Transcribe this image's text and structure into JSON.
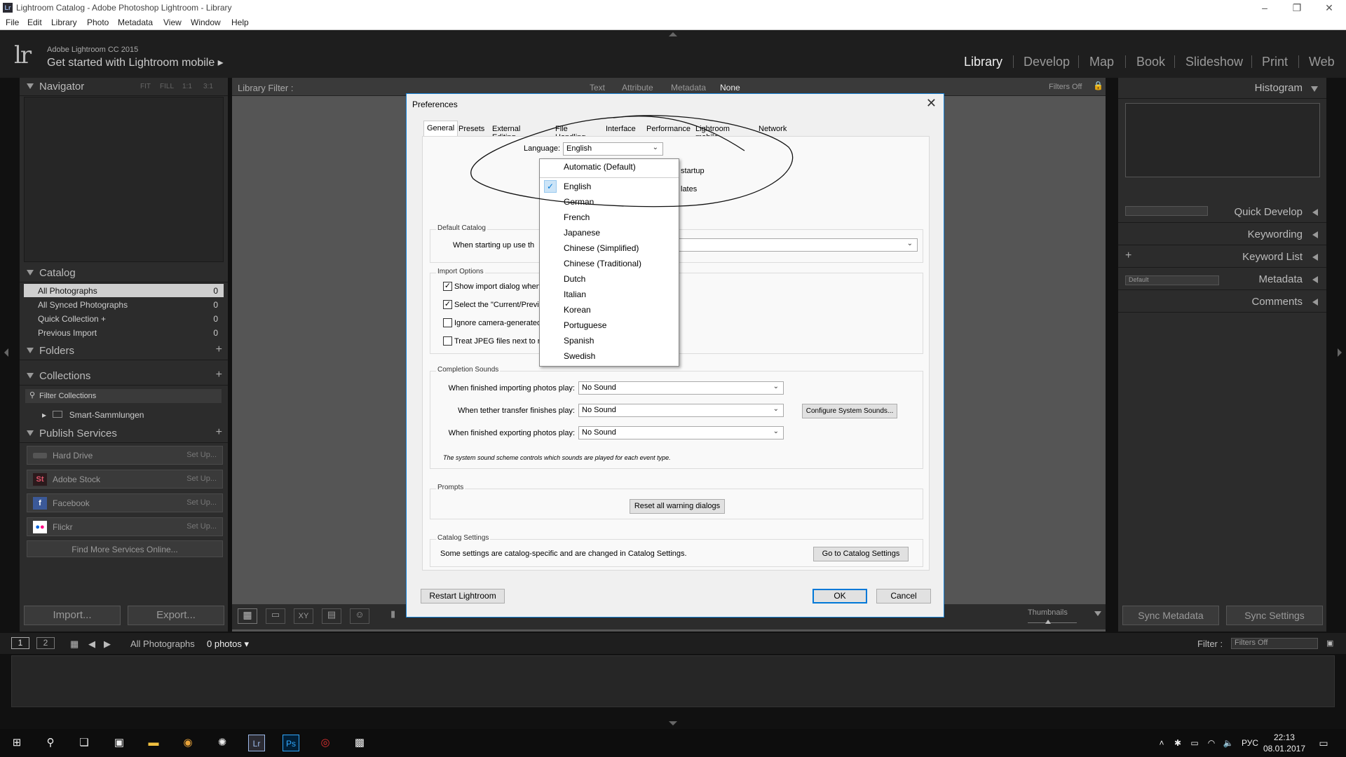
{
  "window": {
    "title": "Lightroom Catalog - Adobe Photoshop Lightroom - Library",
    "logo": "Lr"
  },
  "menu": [
    "File",
    "Edit",
    "Library",
    "Photo",
    "Metadata",
    "View",
    "Window",
    "Help"
  ],
  "header": {
    "logo": "lr",
    "version": "Adobe Lightroom CC 2015",
    "mobile": "Get started with Lightroom mobile",
    "modules": [
      "Library",
      "Develop",
      "Map",
      "Book",
      "Slideshow",
      "Print",
      "Web"
    ],
    "active_module": "Library"
  },
  "left_panel": {
    "navigator": {
      "title": "Navigator",
      "options": [
        "FIT",
        "FILL",
        "1:1",
        "3:1"
      ]
    },
    "catalog": {
      "title": "Catalog",
      "rows": [
        {
          "label": "All Photographs",
          "count": "0"
        },
        {
          "label": "All Synced Photographs",
          "count": "0"
        },
        {
          "label": "Quick Collection +",
          "count": "0"
        },
        {
          "label": "Previous Import",
          "count": "0"
        }
      ]
    },
    "folders": {
      "title": "Folders"
    },
    "collections": {
      "title": "Collections",
      "filter": "Filter Collections",
      "item": "Smart-Sammlungen"
    },
    "publish": {
      "title": "Publish Services",
      "services": [
        {
          "label": "Hard Drive",
          "action": "Set Up..."
        },
        {
          "label": "Adobe Stock",
          "action": "Set Up..."
        },
        {
          "label": "Facebook",
          "action": "Set Up..."
        },
        {
          "label": "Flickr",
          "action": "Set Up..."
        }
      ],
      "find_more": "Find More Services Online..."
    },
    "import_label": "Import...",
    "export_label": "Export..."
  },
  "filter_bar": {
    "label": "Library Filter :",
    "tabs": [
      "Text",
      "Attribute",
      "Metadata",
      "None"
    ],
    "filters_off": "Filters Off"
  },
  "right_panel": {
    "histogram": "Histogram",
    "quick_develop": "Quick Develop",
    "keywording": "Keywording",
    "keyword_list": "Keyword List",
    "metadata": "Metadata",
    "metadata_preset": "Default",
    "comments": "Comments",
    "sync_metadata": "Sync Metadata",
    "sync_settings": "Sync Settings"
  },
  "toolbar": {
    "thumbnails": "Thumbnails"
  },
  "filmstrip_bar": {
    "page1": "1",
    "page2": "2",
    "source": "All Photographs",
    "count": "0 photos",
    "filter_label": "Filter :",
    "filter_value": "Filters Off"
  },
  "taskbar": {
    "lang": "РУС",
    "time": "22:13",
    "date": "08.01.2017"
  },
  "dialog": {
    "title": "Preferences",
    "tabs": [
      "General",
      "Presets",
      "External Editing",
      "File Handling",
      "Interface",
      "Performance",
      "Lightroom mobile",
      "Network"
    ],
    "active_tab": "General",
    "language_label": "Language:",
    "language_value": "English",
    "startup_partial": "startup",
    "updates_partial": "lates",
    "default_catalog": {
      "title": "Default Catalog",
      "label": "When starting up use th"
    },
    "import_options": {
      "title": "Import Options",
      "items": [
        {
          "label": "Show import dialog when",
          "checked": true
        },
        {
          "label": "Select the \"Current/Previo",
          "checked": true
        },
        {
          "label": "Ignore camera-generated",
          "checked": false
        },
        {
          "label": "Treat JPEG files next to ra",
          "checked": false
        }
      ]
    },
    "completion_sounds": {
      "title": "Completion Sounds",
      "rows": [
        {
          "label": "When finished importing photos play:",
          "value": "No Sound"
        },
        {
          "label": "When tether transfer finishes play:",
          "value": "No Sound"
        },
        {
          "label": "When finished exporting photos play:",
          "value": "No Sound"
        }
      ],
      "configure": "Configure System Sounds...",
      "note": "The system sound scheme controls which sounds are played for each event type."
    },
    "prompts": {
      "title": "Prompts",
      "reset": "Reset all warning dialogs"
    },
    "catalog_settings": {
      "title": "Catalog Settings",
      "text": "Some settings are catalog-specific and are changed in Catalog Settings.",
      "button": "Go to Catalog Settings"
    },
    "restart": "Restart Lightroom",
    "ok": "OK",
    "cancel": "Cancel"
  },
  "language_list": {
    "items": [
      "Automatic (Default)",
      "English",
      "German",
      "French",
      "Japanese",
      "Chinese (Simplified)",
      "Chinese (Traditional)",
      "Dutch",
      "Italian",
      "Korean",
      "Portuguese",
      "Spanish",
      "Swedish"
    ],
    "checked": "English"
  }
}
